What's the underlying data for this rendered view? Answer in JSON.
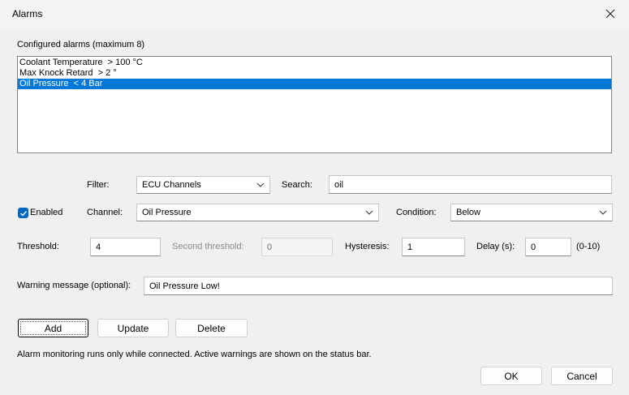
{
  "window": {
    "title": "Alarms"
  },
  "alarms_list": {
    "heading": "Configured alarms (maximum 8)",
    "items": [
      "Coolant Temperature  > 100 °C",
      "Max Knock Retard  > 2 °",
      "Oil Pressure  < 4 Bar"
    ],
    "selected_index": 2
  },
  "filter": {
    "label": "Filter:",
    "value": "ECU Channels"
  },
  "search": {
    "label": "Search:",
    "value": "oil"
  },
  "enabled": {
    "label": "Enabled",
    "checked": true
  },
  "channel": {
    "label": "Channel:",
    "value": "Oil Pressure"
  },
  "condition": {
    "label": "Condition:",
    "value": "Below"
  },
  "threshold": {
    "label": "Threshold:",
    "value": "4"
  },
  "second_threshold": {
    "label": "Second threshold:",
    "value": "0"
  },
  "hysteresis": {
    "label": "Hysteresis:",
    "value": "1"
  },
  "delay": {
    "label": "Delay (s):",
    "value": "0",
    "range": "(0-10)"
  },
  "warning": {
    "label": "Warning message (optional):",
    "value": "Oil Pressure Low!"
  },
  "buttons": {
    "add": "Add",
    "update": "Update",
    "delete": "Delete",
    "ok": "OK",
    "cancel": "Cancel"
  },
  "footer_note": "Alarm monitoring runs only while connected. Active warnings are shown on the status bar.",
  "colors": {
    "selection": "#0078d7",
    "checkbox": "#0067c0"
  }
}
